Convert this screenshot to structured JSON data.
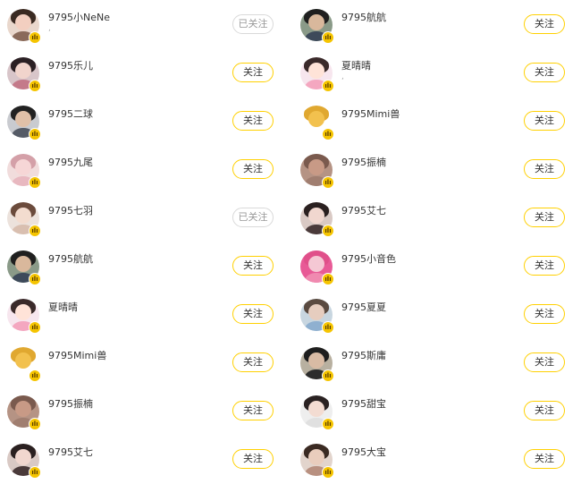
{
  "accent_color": "#ffd000",
  "badge_color": "#f5c400",
  "left_column": [
    {
      "name": "9795小NeNe",
      "sub": ",",
      "button": "已关注",
      "followed": true,
      "avatar_skin": "#f3cfc0",
      "avatar_hair": "#3a2a22",
      "avatar_body": "#8a6a5a",
      "bg": "#e9d7cc"
    },
    {
      "name": "9795乐儿",
      "sub": "",
      "button": "关注",
      "followed": false,
      "avatar_skin": "#f1d4cc",
      "avatar_hair": "#2b2024",
      "avatar_body": "#c47a8a",
      "bg": "#d8c5c9"
    },
    {
      "name": "9795二球",
      "sub": "",
      "button": "关注",
      "followed": false,
      "avatar_skin": "#e0c0a8",
      "avatar_hair": "#222222",
      "avatar_body": "#555b66",
      "bg": "#c9cbd0"
    },
    {
      "name": "9795九尾",
      "sub": "",
      "button": "关注",
      "followed": false,
      "avatar_skin": "#f6d6d6",
      "avatar_hair": "#d4a0a8",
      "avatar_body": "#e8b8c0",
      "bg": "#f1dcdc"
    },
    {
      "name": "9795七羽",
      "sub": "",
      "button": "已关注",
      "followed": true,
      "avatar_skin": "#f3dccf",
      "avatar_hair": "#6b4b3c",
      "avatar_body": "#d9bfb0",
      "bg": "#ece2dc"
    },
    {
      "name": "9795航航",
      "sub": "",
      "button": "关注",
      "followed": false,
      "avatar_skin": "#d9b89c",
      "avatar_hair": "#1f1f1f",
      "avatar_body": "#3d4a5a",
      "bg": "#8a9a88"
    },
    {
      "name": "夏晴晴",
      "sub": "",
      "button": "关注",
      "followed": false,
      "avatar_skin": "#ffe3d8",
      "avatar_hair": "#3a2a2a",
      "avatar_body": "#f4a7c0",
      "bg": "#f7e6ee"
    },
    {
      "name": "9795Mimi兽",
      "sub": "",
      "button": "关注",
      "followed": false,
      "avatar_skin": "#f2c14e",
      "avatar_hair": "#e0a830",
      "avatar_body": "#ffffff",
      "bg": "#ffffff"
    },
    {
      "name": "9795振楠",
      "sub": "",
      "button": "关注",
      "followed": false,
      "avatar_skin": "#c89a86",
      "avatar_hair": "#7a5a4e",
      "avatar_body": "#a07e70",
      "bg": "#b59384"
    },
    {
      "name": "9795艾七",
      "sub": "",
      "button": "关注",
      "followed": false,
      "avatar_skin": "#f1d7cf",
      "avatar_hair": "#2a2020",
      "avatar_body": "#4a3a3a",
      "bg": "#d9c9c4"
    }
  ],
  "right_column": [
    {
      "name": "9795航航",
      "sub": "",
      "button": "关注",
      "followed": false,
      "avatar_skin": "#d9b89c",
      "avatar_hair": "#1f1f1f",
      "avatar_body": "#3d4a5a",
      "bg": "#8a9a88"
    },
    {
      "name": "夏晴晴",
      "sub": ",",
      "button": "关注",
      "followed": false,
      "avatar_skin": "#ffe3d8",
      "avatar_hair": "#3a2a2a",
      "avatar_body": "#f4a7c0",
      "bg": "#f7e6ee"
    },
    {
      "name": "9795Mimi兽",
      "sub": "",
      "button": "关注",
      "followed": false,
      "avatar_skin": "#f2c14e",
      "avatar_hair": "#e0a830",
      "avatar_body": "#ffffff",
      "bg": "#ffffff"
    },
    {
      "name": "9795振楠",
      "sub": "",
      "button": "关注",
      "followed": false,
      "avatar_skin": "#c89a86",
      "avatar_hair": "#7a5a4e",
      "avatar_body": "#a07e70",
      "bg": "#b59384"
    },
    {
      "name": "9795艾七",
      "sub": "",
      "button": "关注",
      "followed": false,
      "avatar_skin": "#f1d7cf",
      "avatar_hair": "#2a2020",
      "avatar_body": "#4a3a3a",
      "bg": "#d9c9c4"
    },
    {
      "name": "9795小音色",
      "sub": "",
      "button": "关注",
      "followed": false,
      "avatar_skin": "#f5c8d4",
      "avatar_hair": "#e0508a",
      "avatar_body": "#f08ab0",
      "bg": "#e85a96"
    },
    {
      "name": "9795夏夏",
      "sub": "",
      "button": "关注",
      "followed": false,
      "avatar_skin": "#e6cdbf",
      "avatar_hair": "#5a4a40",
      "avatar_body": "#8fb0d0",
      "bg": "#c8d6e0"
    },
    {
      "name": "9795斯庸",
      "sub": "",
      "button": "关注",
      "followed": false,
      "avatar_skin": "#d9bba4",
      "avatar_hair": "#1e1e1e",
      "avatar_body": "#2c2c2c",
      "bg": "#b8b0a0"
    },
    {
      "name": "9795甜宝",
      "sub": "",
      "button": "关注",
      "followed": false,
      "avatar_skin": "#f3dcd2",
      "avatar_hair": "#2a2222",
      "avatar_body": "#e0e0e0",
      "bg": "#eeeeee"
    },
    {
      "name": "9795大宝",
      "sub": "",
      "button": "关注",
      "followed": false,
      "avatar_skin": "#e9cdbd",
      "avatar_hair": "#3a2a22",
      "avatar_body": "#b89080",
      "bg": "#e2d4cc"
    }
  ]
}
